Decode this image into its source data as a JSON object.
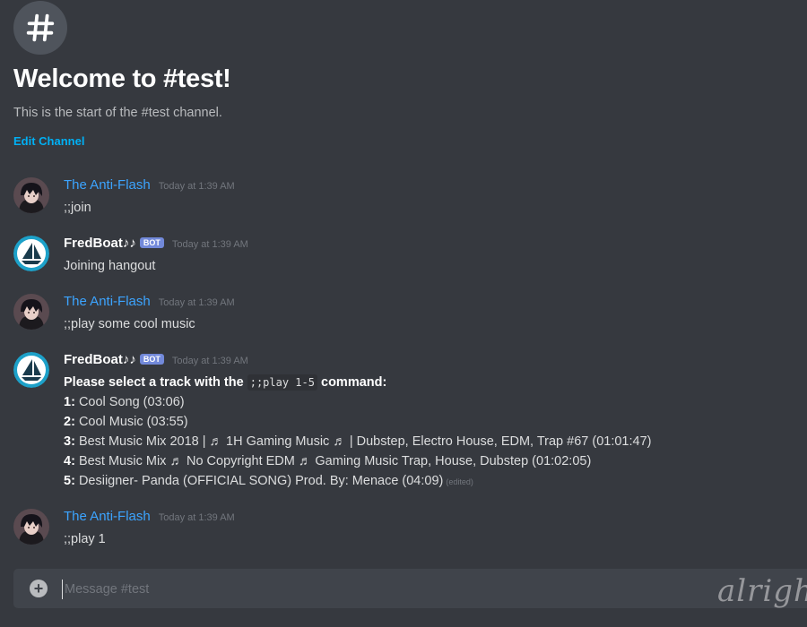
{
  "channel": {
    "welcome_title": "Welcome to #test!",
    "welcome_sub": "This is the start of the #test channel.",
    "edit_label": "Edit Channel"
  },
  "messages": [
    {
      "author": "The Anti-Flash",
      "timestamp": "Today at 1:39 AM",
      "content": ";;join"
    },
    {
      "author": "FredBoat♪♪",
      "bot_tag": "BOT",
      "timestamp": "Today at 1:39 AM",
      "content": "Joining hangout"
    },
    {
      "author": "The Anti-Flash",
      "timestamp": "Today at 1:39 AM",
      "content": ";;play some cool music"
    },
    {
      "author": "FredBoat♪♪",
      "bot_tag": "BOT",
      "timestamp": "Today at 1:39 AM",
      "intro_before": "Please select a track with the",
      "intro_code": ";;play 1-5",
      "intro_after": "command:",
      "tracks": [
        {
          "num": "1:",
          "title": "Cool Song (03:06)"
        },
        {
          "num": "2:",
          "title": "Cool Music (03:55)"
        },
        {
          "num": "3:",
          "title": "Best Music Mix 2018 | ♬ 1H Gaming Music ♬ | Dubstep, Electro House, EDM, Trap #67 (01:01:47)"
        },
        {
          "num": "4:",
          "title": "Best Music Mix ♬ No Copyright EDM ♬ Gaming Music Trap, House, Dubstep (01:02:05)"
        },
        {
          "num": "5:",
          "title": "Desiigner- Panda (OFFICIAL SONG) Prod. By: Menace (04:09)"
        }
      ],
      "edited_label": "(edited)"
    },
    {
      "author": "The Anti-Flash",
      "timestamp": "Today at 1:39 AM",
      "content": ";;play 1"
    }
  ],
  "composer": {
    "placeholder": "Message #test"
  },
  "watermark": "alrigh",
  "colors": {
    "background": "#36393f",
    "human_username": "#3ca4ff",
    "bot_tag": "#7289da",
    "link": "#00b0f4",
    "composer_bg": "#40444b"
  },
  "icons": {
    "channel": "hash-icon",
    "composer_add": "plus-circle-icon",
    "human_avatar": "anime-boy-avatar",
    "bot_avatar": "sailboat-logo-avatar"
  }
}
